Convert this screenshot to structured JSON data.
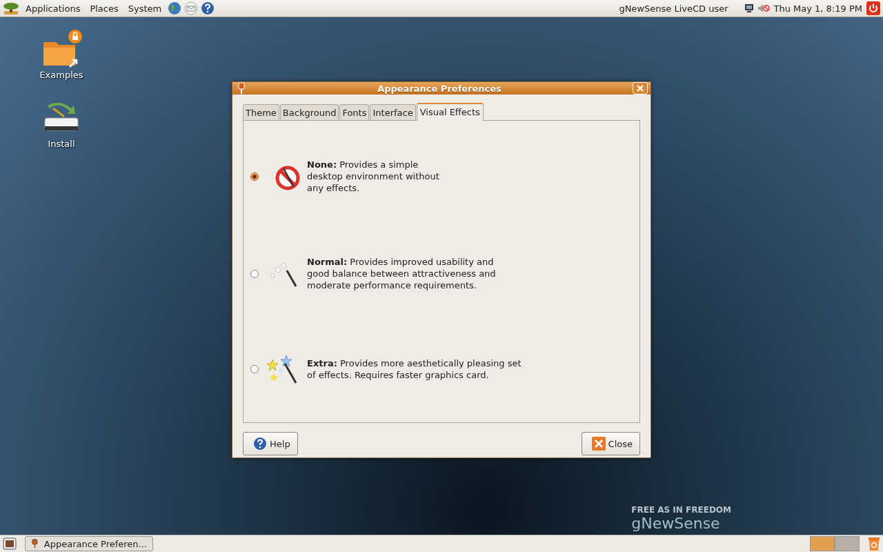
{
  "top_panel": {
    "menus": [
      "Applications",
      "Places",
      "System"
    ],
    "user": "gNewSense LiveCD user",
    "clock": "Thu May  1,  8:19 PM"
  },
  "desktop_icons": [
    {
      "label": "Examples",
      "kind": "folder"
    },
    {
      "label": "Install",
      "kind": "drive"
    }
  ],
  "wallpaper": {
    "tagline": "FREE AS IN FREEDOM",
    "logo": "gNewSense"
  },
  "window": {
    "title": "Appearance Preferences",
    "tabs": [
      {
        "label": "Theme",
        "selected": false
      },
      {
        "label": "Background",
        "selected": false
      },
      {
        "label": "Fonts",
        "selected": false
      },
      {
        "label": "Interface",
        "selected": false
      },
      {
        "label": "Visual Effects",
        "selected": true
      }
    ],
    "options": [
      {
        "kind": "none",
        "text": "**None:** Provides a simple\ndesktop environment without\nany effects.",
        "selected": true
      },
      {
        "kind": "normal",
        "text": "**Normal:** Provides improved usability and\ngood balance between attractiveness and\nmoderate performance requirements.",
        "selected": false
      },
      {
        "kind": "extra",
        "text": "**Extra:** Provides more aesthetically pleasing set\nof effects. Requires faster graphics card.",
        "selected": false
      }
    ],
    "buttons": [
      {
        "label": "Help",
        "kind": "help"
      },
      {
        "label": "Close",
        "kind": "close"
      }
    ]
  },
  "taskbar": {
    "items": [
      {
        "label": "Appearance Preferen...",
        "selected": false
      }
    ]
  }
}
